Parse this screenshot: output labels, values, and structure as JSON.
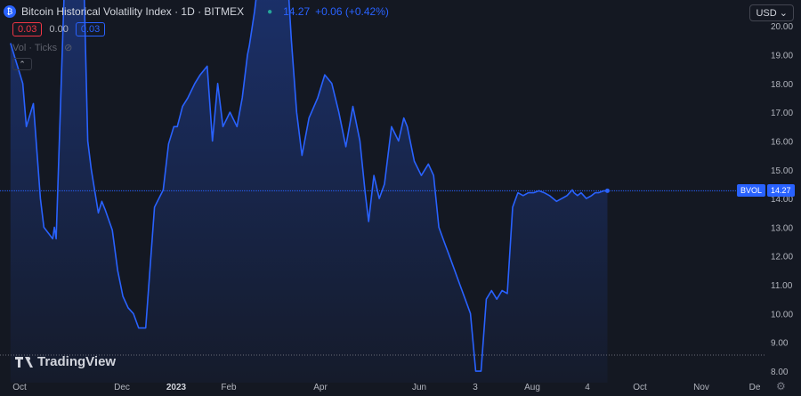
{
  "header": {
    "icon": "bitcoin-volatility-icon",
    "title": "Bitcoin Historical Volatility Index · 1D · BITMEX",
    "price": "14.27",
    "change": "+0.06 (+0.42%)"
  },
  "indicator_row": {
    "val1": "0.03",
    "val2": "0.00",
    "val3": "0.03"
  },
  "volume_label": "Vol · Ticks",
  "currency": "USD",
  "brand": "TradingView",
  "price_tag": {
    "symbol": "BVOL",
    "value": "14.27"
  },
  "colors": {
    "background": "#141822",
    "line": "#2962ff",
    "up": "#26a69a",
    "down": "#f23645"
  },
  "chart_data": {
    "type": "area",
    "series": [
      {
        "name": "BVOL",
        "x": [
          "2022-10-01",
          "2022-10-08",
          "2022-10-10",
          "2022-10-14",
          "2022-10-18",
          "2022-10-20",
          "2022-10-25",
          "2022-10-26",
          "2022-10-27",
          "2022-11-01",
          "2022-11-06",
          "2022-11-08",
          "2022-11-10",
          "2022-11-12",
          "2022-11-14",
          "2022-11-16",
          "2022-11-20",
          "2022-11-22",
          "2022-11-24",
          "2022-11-28",
          "2022-12-01",
          "2022-12-04",
          "2022-12-07",
          "2022-12-10",
          "2022-12-13",
          "2022-12-17",
          "2022-12-22",
          "2022-12-27",
          "2022-12-30",
          "2023-01-02",
          "2023-01-04",
          "2023-01-07",
          "2023-01-10",
          "2023-01-14",
          "2023-01-17",
          "2023-01-21",
          "2023-01-24",
          "2023-01-27",
          "2023-01-30",
          "2023-02-03",
          "2023-02-07",
          "2023-02-10",
          "2023-02-13",
          "2023-02-14",
          "2023-02-17",
          "2023-02-20",
          "2023-02-23",
          "2023-02-26",
          "2023-03-01",
          "2023-03-05",
          "2023-03-08",
          "2023-03-10",
          "2023-03-13",
          "2023-03-16",
          "2023-03-20",
          "2023-03-25",
          "2023-03-29",
          "2023-04-02",
          "2023-04-06",
          "2023-04-10",
          "2023-04-14",
          "2023-04-18",
          "2023-04-21",
          "2023-04-23",
          "2023-04-26",
          "2023-04-29",
          "2023-05-02",
          "2023-05-06",
          "2023-05-10",
          "2023-05-13",
          "2023-05-15",
          "2023-05-19",
          "2023-05-23",
          "2023-05-27",
          "2023-05-30",
          "2023-06-02",
          "2023-06-05",
          "2023-06-08",
          "2023-06-11",
          "2023-06-14",
          "2023-06-17",
          "2023-06-20",
          "2023-06-23",
          "2023-06-26",
          "2023-06-29",
          "2023-07-02",
          "2023-07-05",
          "2023-07-08",
          "2023-07-11",
          "2023-07-14",
          "2023-07-17",
          "2023-07-20",
          "2023-07-23",
          "2023-07-26",
          "2023-07-29",
          "2023-08-01",
          "2023-08-04",
          "2023-08-08",
          "2023-08-11",
          "2023-08-14",
          "2023-08-17",
          "2023-08-18",
          "2023-08-20",
          "2023-08-22",
          "2023-08-25",
          "2023-08-28",
          "2023-08-30",
          "2023-09-01",
          "2023-09-04",
          "2023-09-06"
        ],
        "values": [
          19.4,
          18.0,
          16.5,
          17.3,
          14.0,
          13.0,
          12.6,
          13.0,
          12.6,
          22.0,
          24.0,
          24.0,
          22.0,
          21.0,
          16.0,
          15.0,
          13.5,
          13.9,
          13.6,
          12.9,
          11.5,
          10.6,
          10.2,
          10.0,
          9.5,
          9.5,
          13.7,
          14.3,
          15.9,
          16.5,
          16.5,
          17.2,
          17.5,
          18.0,
          18.3,
          18.6,
          16.0,
          18.0,
          16.5,
          17.0,
          16.5,
          17.5,
          19.0,
          19.3,
          20.5,
          22.0,
          22.5,
          22.5,
          22.0,
          22.5,
          21.5,
          19.5,
          17.0,
          15.5,
          16.8,
          17.5,
          18.3,
          18.0,
          17.0,
          15.8,
          17.2,
          16.0,
          14.2,
          13.2,
          14.8,
          14.0,
          14.5,
          16.5,
          16.0,
          16.8,
          16.5,
          15.3,
          14.8,
          15.2,
          14.8,
          13.0,
          12.5,
          12.0,
          11.5,
          11.0,
          10.5,
          10.0,
          8.0,
          8.0,
          10.5,
          10.8,
          10.5,
          10.8,
          10.7,
          13.7,
          14.2,
          14.1,
          14.2,
          14.2,
          14.27,
          14.2,
          14.1,
          13.9,
          14.0,
          14.1,
          14.3,
          14.2,
          14.1,
          14.2,
          14.0,
          14.1,
          14.2,
          14.2,
          14.27,
          14.27
        ]
      }
    ],
    "x_tick_labels": [
      "Oct",
      "Dec",
      "2023",
      "Feb",
      "Apr",
      "Jun",
      "3",
      "Aug",
      "4",
      "Oct",
      "Nov",
      "De"
    ],
    "y_ticks": [
      "8.00",
      "9.00",
      "10.00",
      "11.00",
      "12.00",
      "13.00",
      "14.00",
      "15.00",
      "16.00",
      "17.00",
      "18.00",
      "19.00",
      "20.00"
    ],
    "ylim": [
      7.6,
      20.9
    ],
    "xlim": [
      "2022-09-25",
      "2023-12-05"
    ],
    "current_value": 14.27,
    "grid": false
  }
}
